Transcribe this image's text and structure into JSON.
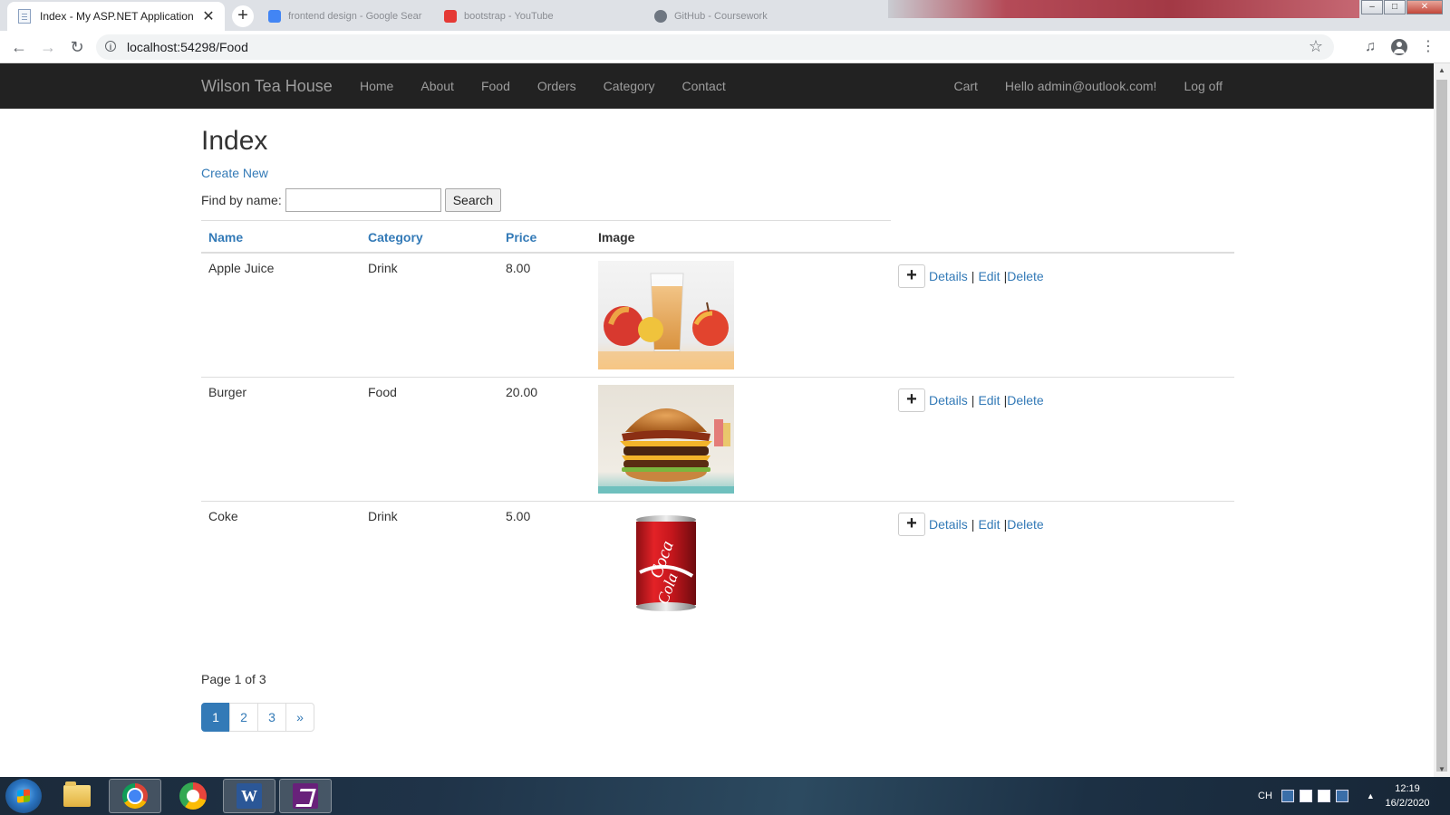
{
  "browser": {
    "active_tab_title": "Index - My ASP.NET Application",
    "tab_close": "✕",
    "new_tab": "+",
    "background_tabs": [
      {
        "title": "frontend design - Google Sear",
        "color": "#4285f4"
      },
      {
        "title": "bootstrap - YouTube",
        "color": "#e53935"
      },
      {
        "title": "GitHub - Coursework",
        "color": "#6e7681"
      }
    ],
    "url": "localhost:54298/Food",
    "back_icon": "←",
    "forward_icon": "→",
    "reload_icon": "↻",
    "star_icon": "☆",
    "media_icon": "♫",
    "menu_icon": "⋮",
    "window_controls": [
      "–",
      "□",
      "✕"
    ]
  },
  "site_nav": {
    "brand": "Wilson Tea House",
    "links": [
      "Home",
      "About",
      "Food",
      "Orders",
      "Category",
      "Contact"
    ],
    "right_links": [
      "Cart",
      "Hello admin@outlook.com!",
      "Log off"
    ]
  },
  "main": {
    "title": "Index",
    "create_new": "Create New",
    "search_label": "Find by name:",
    "search_value": "",
    "search_button": "Search",
    "columns": {
      "name": "Name",
      "category": "Category",
      "price": "Price",
      "image": "Image"
    },
    "rows": [
      {
        "name": "Apple Juice",
        "category": "Drink",
        "price": "8.00",
        "image": "apple-juice"
      },
      {
        "name": "Burger",
        "category": "Food",
        "price": "20.00",
        "image": "burger"
      },
      {
        "name": "Coke",
        "category": "Drink",
        "price": "5.00",
        "image": "coke-can"
      }
    ],
    "actions": {
      "add": "+",
      "details": "Details",
      "edit": "Edit",
      "delete": "Delete",
      "separator": "|"
    },
    "page_info": "Page 1 of 3",
    "pagination": [
      "1",
      "2",
      "3",
      "»"
    ],
    "current_page": "1"
  },
  "taskbar": {
    "apps": [
      "file-explorer",
      "chrome",
      "chrome-canary",
      "word",
      "visual-studio"
    ],
    "lang": "CH",
    "time": "12:19",
    "date": "16/2/2020",
    "tray_up": "▲"
  }
}
